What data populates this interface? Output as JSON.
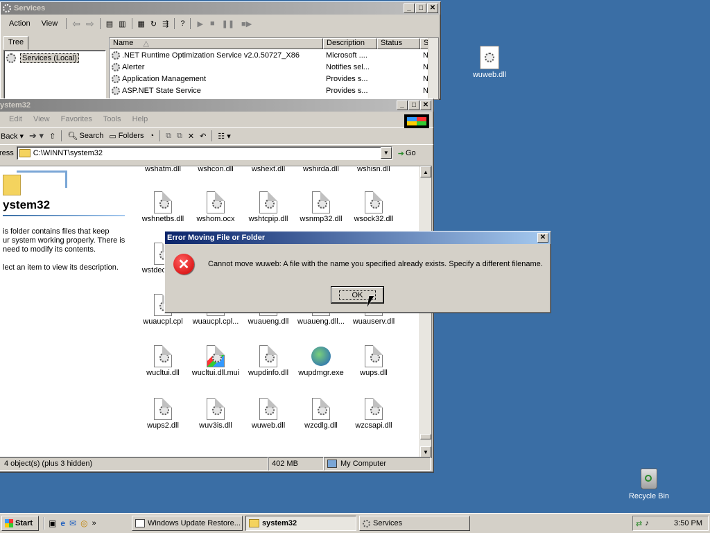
{
  "desktop": {
    "icons": [
      {
        "label": "wuweb.dll"
      },
      {
        "label": "Recycle Bin"
      }
    ]
  },
  "services": {
    "title": "Services",
    "menu": [
      "Action",
      "View"
    ],
    "tree_tab": "Tree",
    "tree_root": "Services (Local)",
    "columns": [
      "Name",
      "Description",
      "Status",
      "S"
    ],
    "rows": [
      {
        "name": ".NET Runtime Optimization Service v2.0.50727_X86",
        "desc": "Microsoft ....",
        "status": "",
        "s": "N"
      },
      {
        "name": "Alerter",
        "desc": "Notifies sel...",
        "status": "",
        "s": "N"
      },
      {
        "name": "Application Management",
        "desc": "Provides s...",
        "status": "",
        "s": "N"
      },
      {
        "name": "ASP.NET State Service",
        "desc": "Provides s...",
        "status": "",
        "s": "N"
      }
    ]
  },
  "explorer": {
    "title": "ystem32",
    "menu": [
      "Edit",
      "View",
      "Favorites",
      "Tools",
      "Help"
    ],
    "toolbar": {
      "back": "Back",
      "search": "Search",
      "folders": "Folders"
    },
    "address_label": "ress",
    "address_value": "C:\\WINNT\\system32",
    "go": "Go",
    "folder_heading": "ystem32",
    "folder_desc": "is folder contains files that keep\nur system working properly. There is\nneed to modify its contents.",
    "folder_hint": "lect an item to view its description.",
    "top_row": [
      "wshatm.dll",
      "wshcon.dll",
      "wshext.dll",
      "wshirda.dll",
      "wshisn.dll"
    ],
    "files": [
      [
        "wshnetbs.dll",
        "wshom.ocx",
        "wshtcpip.dll",
        "wsnmp32.dll",
        "wsock32.dll"
      ],
      [
        "wstdecod.dll",
        "",
        "",
        "",
        ""
      ],
      [
        "wuaucpl.cpl",
        "wuaucpl.cpl...",
        "wuaueng.dll",
        "wuaueng.dll...",
        "wuauserv.dll"
      ],
      [
        "wucltui.dll",
        "wucltui.dll.mui",
        "wupdinfo.dll",
        "wupdmgr.exe",
        "wups.dll"
      ],
      [
        "wups2.dll",
        "wuv3is.dll",
        "wuweb.dll",
        "wzcdlg.dll",
        "wzcsapi.dll"
      ]
    ],
    "status": {
      "objects": "4 object(s) (plus 3 hidden)",
      "size": "402 MB",
      "location": "My Computer"
    }
  },
  "dialog": {
    "title": "Error Moving File or Folder",
    "message": "Cannot move wuweb: A file with the name you specified already exists. Specify a different filename.",
    "ok": "OK"
  },
  "taskbar": {
    "start": "Start",
    "tasks": [
      "Windows Update Restore...",
      "system32",
      "Services"
    ],
    "clock": "3:50 PM"
  },
  "colors": {
    "desktop": "#3a6ea5",
    "title_active": "#0a246a",
    "title_inactive": "#808080",
    "error_red": "#e02020"
  }
}
